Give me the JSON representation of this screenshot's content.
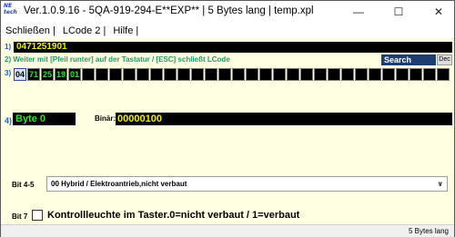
{
  "window": {
    "logo_text": "NE tech",
    "title": "Ver.1.0.9.16 -  5QA-919-294-E**EXP** | 5 Bytes lang | temp.xpl",
    "controls": {
      "minimize": "—",
      "maximize": "☐",
      "close": "✕"
    }
  },
  "menu": {
    "items": [
      "Schließen |",
      "LCode 2 |",
      "Hilfe |"
    ]
  },
  "row1": {
    "num": "1)",
    "value": "0471251901"
  },
  "row2": {
    "num": "2)",
    "text": "Weiter mit [Pfeil runter] auf der Tastatur / [ESC] schließt LCode",
    "search_label": "Search",
    "dec_label": "Dec"
  },
  "row3": {
    "num": "3)",
    "bytes": [
      "04",
      "71",
      "25",
      "19",
      "01",
      "",
      "",
      "",
      "",
      "",
      "",
      "",
      "",
      "",
      "",
      "",
      "",
      "",
      "",
      "",
      "",
      "",
      "",
      "",
      "",
      "",
      "",
      "",
      "",
      "",
      "",
      ""
    ]
  },
  "row4": {
    "num": "4)",
    "byte_label": "Byte 0",
    "binar_label": "Binär:",
    "binar_value": "00000100"
  },
  "bit45": {
    "label": "Bit 4-5",
    "selected": "00 Hybrid / Elektroantrieb,nicht verbaut"
  },
  "bit7": {
    "label": "Bit 7",
    "checked": false,
    "text": "Kontrollleuchte im Taster.0=nicht verbaut / 1=verbaut"
  },
  "status": {
    "text": "5 Bytes lang"
  },
  "colors": {
    "window_bg": "#ffffe1",
    "yellow_text": "#f0f000",
    "green_text": "#33e033",
    "search_bg": "#1c3c72"
  }
}
